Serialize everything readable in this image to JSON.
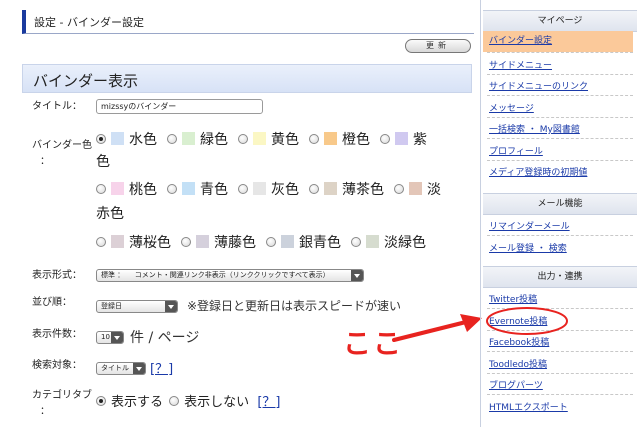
{
  "main": {
    "breadcrumb": "設定 - バインダー設定",
    "update_button": "更新",
    "section_title": "バインダー表示",
    "title_row": {
      "label": "タイトル：",
      "value": "mizssyのバインダー"
    },
    "color_row": {
      "label": "バインダー色",
      "label_colon": "：",
      "options": [
        {
          "label": "水色",
          "color": "#cfe0f5",
          "selected": true
        },
        {
          "label": "緑色",
          "color": "#d9efd0",
          "selected": false
        },
        {
          "label": "黄色",
          "color": "#fbf7c4",
          "selected": false
        },
        {
          "label": "橙色",
          "color": "#f8c98a",
          "selected": false
        },
        {
          "label": "紫色",
          "color": "#d0c9f0",
          "selected": false
        },
        {
          "label": "桃色",
          "color": "#f7d3ea",
          "selected": false
        },
        {
          "label": "青色",
          "color": "#c3e0f6",
          "selected": false
        },
        {
          "label": "灰色",
          "color": "#e6e6e6",
          "selected": false
        },
        {
          "label": "薄茶色",
          "color": "#ddd3c6",
          "selected": false
        },
        {
          "label": "淡赤色",
          "color": "#e3c6b8",
          "selected": false
        },
        {
          "label": "薄桜色",
          "color": "#dcd0d6",
          "selected": false
        },
        {
          "label": "薄藤色",
          "color": "#d5d0dc",
          "selected": false
        },
        {
          "label": "銀青色",
          "color": "#ccd2dc",
          "selected": false
        },
        {
          "label": "淡緑色",
          "color": "#d6dccf",
          "selected": false
        }
      ]
    },
    "display_format": {
      "label": "表示形式：",
      "value": "標準 ：　　コメント・関連リンク非表示（リンククリックですべて表示）"
    },
    "sort": {
      "label": "並び順：",
      "value": "登録日",
      "note": "※登録日と更新日は表示スピードが速い"
    },
    "count": {
      "label": "表示件数：",
      "value": "10",
      "unit": "件 / ページ"
    },
    "search_target": {
      "label": "検索対象：",
      "value": "タイトル",
      "help": "[？]"
    },
    "category_tab": {
      "label": "カテゴリタブ",
      "label_colon": "：",
      "show": "表示する",
      "hide": "表示しない",
      "help": "[？]",
      "selected": "show"
    }
  },
  "annotation": {
    "text": "ここ",
    "color": "#e8231f"
  },
  "sidebar": {
    "mypage": {
      "title": "マイページ",
      "items": [
        "バインダー設定",
        "サイドメニュー",
        "サイドメニューのリンク",
        "メッセージ",
        "一括検索 ・ My図書館",
        "プロフィール",
        "メディア登録時の初期値"
      ]
    },
    "mail": {
      "title": "メール機能",
      "items": [
        "リマインダーメール",
        "メール登録 ・ 検索"
      ]
    },
    "output": {
      "title": "出力・連携",
      "items": [
        "Twitter投稿",
        "Evernote投稿",
        "Facebook投稿",
        "Toodledo投稿",
        "ブログパーツ",
        "HTMLエクスポート"
      ]
    },
    "active_color": "#fbc99a",
    "link_color": "#1a3aa8"
  }
}
